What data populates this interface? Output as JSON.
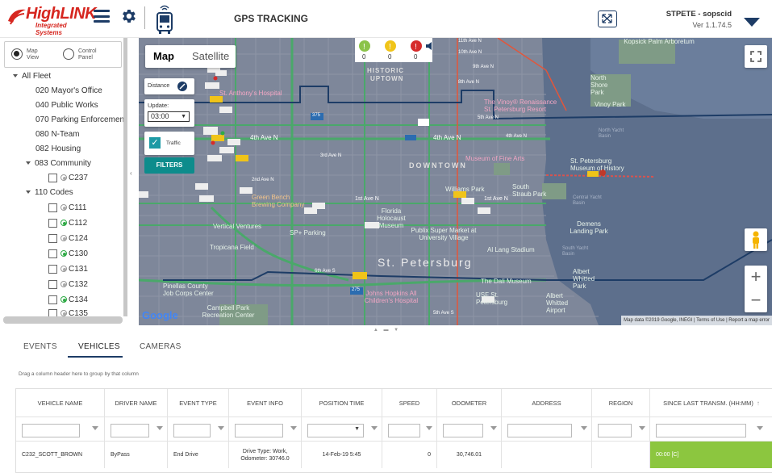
{
  "header": {
    "logo_text": "HighLINK",
    "logo_subtext": "Integrated Systems",
    "title": "GPS TRACKING",
    "user": "STPETE - sopscid",
    "version": "Ver 1.1.74.5"
  },
  "view_toggle": {
    "map_view": "Map View",
    "control_panel": "Control Panel",
    "selected": "Map View"
  },
  "fleet_tree": {
    "root": "All Fleet",
    "items": [
      {
        "label": "020 Mayor's Office"
      },
      {
        "label": "040 Public Works"
      },
      {
        "label": "070 Parking Enforcement"
      },
      {
        "label": "080 N-Team"
      },
      {
        "label": "082 Housing"
      },
      {
        "label": "083 Community",
        "children": [
          {
            "label": "C237",
            "status": "gray"
          }
        ]
      },
      {
        "label": "110 Codes",
        "children": [
          {
            "label": "C111",
            "status": "gray"
          },
          {
            "label": "C112",
            "status": "green"
          },
          {
            "label": "C124",
            "status": "gray"
          },
          {
            "label": "C130",
            "status": "green"
          },
          {
            "label": "C131",
            "status": "gray"
          },
          {
            "label": "C132",
            "status": "gray"
          },
          {
            "label": "C134",
            "status": "green"
          },
          {
            "label": "C135",
            "status": "gray"
          }
        ]
      }
    ]
  },
  "map": {
    "type_map": "Map",
    "type_satellite": "Satellite",
    "distance_label": "Distance",
    "update_label": "Update:",
    "update_value": "03:00",
    "traffic_label": "Traffic",
    "filters_button": "FILTERS",
    "status_counts": [
      "0",
      "0",
      "0"
    ],
    "google": "Google",
    "attribution": "Map data ©2019 Google, INEGI  |  Terms of Use  |  Report a map error",
    "labels": {
      "historic": "HISTORIC",
      "uptown": "UPTOWN",
      "downtown": "DOWNTOWN",
      "st_petersburg": "St. Petersburg",
      "kopsick": "Kopsick Palm Arboretum",
      "north_shore": "North Shore Park",
      "vinoy_park": "Vinoy Park",
      "vinoy_renaissance": "The Vinoy® Renaissance St. Petersburg Resort",
      "museum_fine_arts": "Museum of Fine Arts",
      "museum_history": "St. Petersburg Museum of History",
      "williams_park": "Williams Park",
      "south_straub": "South Straub Park",
      "holocaust": "Florida Holocaust Museum",
      "publix": "Publix Super Market at University Village",
      "demens": "Demens Landing Park",
      "al_lang": "Al Lang Stadium",
      "dali": "The Dali Museum",
      "albert_whitted_park": "Albert Whitted Park",
      "albert_whitted_airport": "Albert Whitted Airport",
      "tropicana": "Tropicana Field",
      "vertical_ventures": "Vertical Ventures",
      "green_bench": "Green Bench Brewing Company",
      "pinellas": "Pinellas County Job Corps Center",
      "campbell": "Campbell Park Recreation Center",
      "johns_hopkins": "Johns Hopkins All Children's Hospital",
      "usf": "USF St. Petersburg",
      "sp_parking": "SP+ Parking",
      "st_anthony": "St. Anthony's Hospital",
      "central_yacht": "Central Yacht Basin",
      "north_yacht": "North Yacht Basin",
      "south_yacht": "South Yacht Basin",
      "4th_ave_n": "4th Ave N",
      "5th_ave_n": "5th Ave N",
      "1st_ave_n": "1st Ave N",
      "2nd_ave_n": "2nd Ave N",
      "3rd_ave_n": "3rd Ave N",
      "6th_ave_s": "6th Ave S",
      "5th_ave_s": "5th Ave S",
      "8th_ave_n": "8th Ave N",
      "9th_ave_n": "9th Ave N",
      "10th_ave_n": "10th Ave N",
      "11th_ave_n": "11th Ave N",
      "375": "375",
      "275": "275"
    }
  },
  "tabs": [
    {
      "label": "EVENTS"
    },
    {
      "label": "VEHICLES",
      "active": true
    },
    {
      "label": "CAMERAS"
    }
  ],
  "grid": {
    "group_hint": "Drag a column header here to group by that column",
    "columns": [
      "VEHICLE NAME",
      "DRIVER NAME",
      "EVENT TYPE",
      "EVENT INFO",
      "POSITION TIME",
      "SPEED",
      "ODOMETER",
      "ADDRESS",
      "REGION",
      "SINCE LAST TRANSM. (HH:MM)"
    ],
    "rows": [
      {
        "vehicle_name": "C232_SCOTT_BROWN",
        "driver_name": "ByPass",
        "event_type": "End Drive",
        "event_info_1": "Drive Type: Work,",
        "event_info_2": "Odometer: 30746.0",
        "position_time": "14-Feb-19 5:45",
        "speed": "0",
        "odometer": "30,746.01",
        "address": "",
        "region": "",
        "since_last": "00:00 [C]"
      }
    ]
  },
  "colors": {
    "brand": "#d6261f",
    "accent": "#1d3c66",
    "filters": "#0d8c8c",
    "since_last_bg": "#8cc63f"
  }
}
